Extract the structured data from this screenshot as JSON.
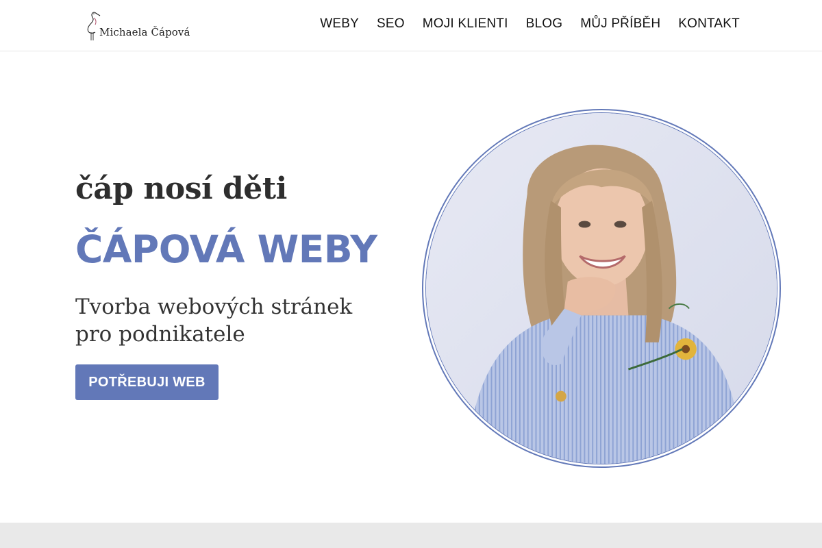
{
  "logo": {
    "name": "Michaela Čápová",
    "icon": "stork-icon"
  },
  "nav": {
    "items": [
      {
        "label": "WEBY"
      },
      {
        "label": "SEO"
      },
      {
        "label": "MOJI KLIENTI"
      },
      {
        "label": "BLOG"
      },
      {
        "label": "MŮJ PŘÍBĚH"
      },
      {
        "label": "KONTAKT"
      }
    ]
  },
  "hero": {
    "tagline": "čáp nosí děti",
    "brand": "ČÁPOVÁ WEBY",
    "subtitle_line1": "Tvorba webových stránek",
    "subtitle_line2": "pro podnikatele",
    "cta_label": "POTŘEBUJI WEB"
  },
  "colors": {
    "accent": "#6278b8",
    "text_dark": "#2e2e2e",
    "footer_band": "#e9e9e9"
  }
}
